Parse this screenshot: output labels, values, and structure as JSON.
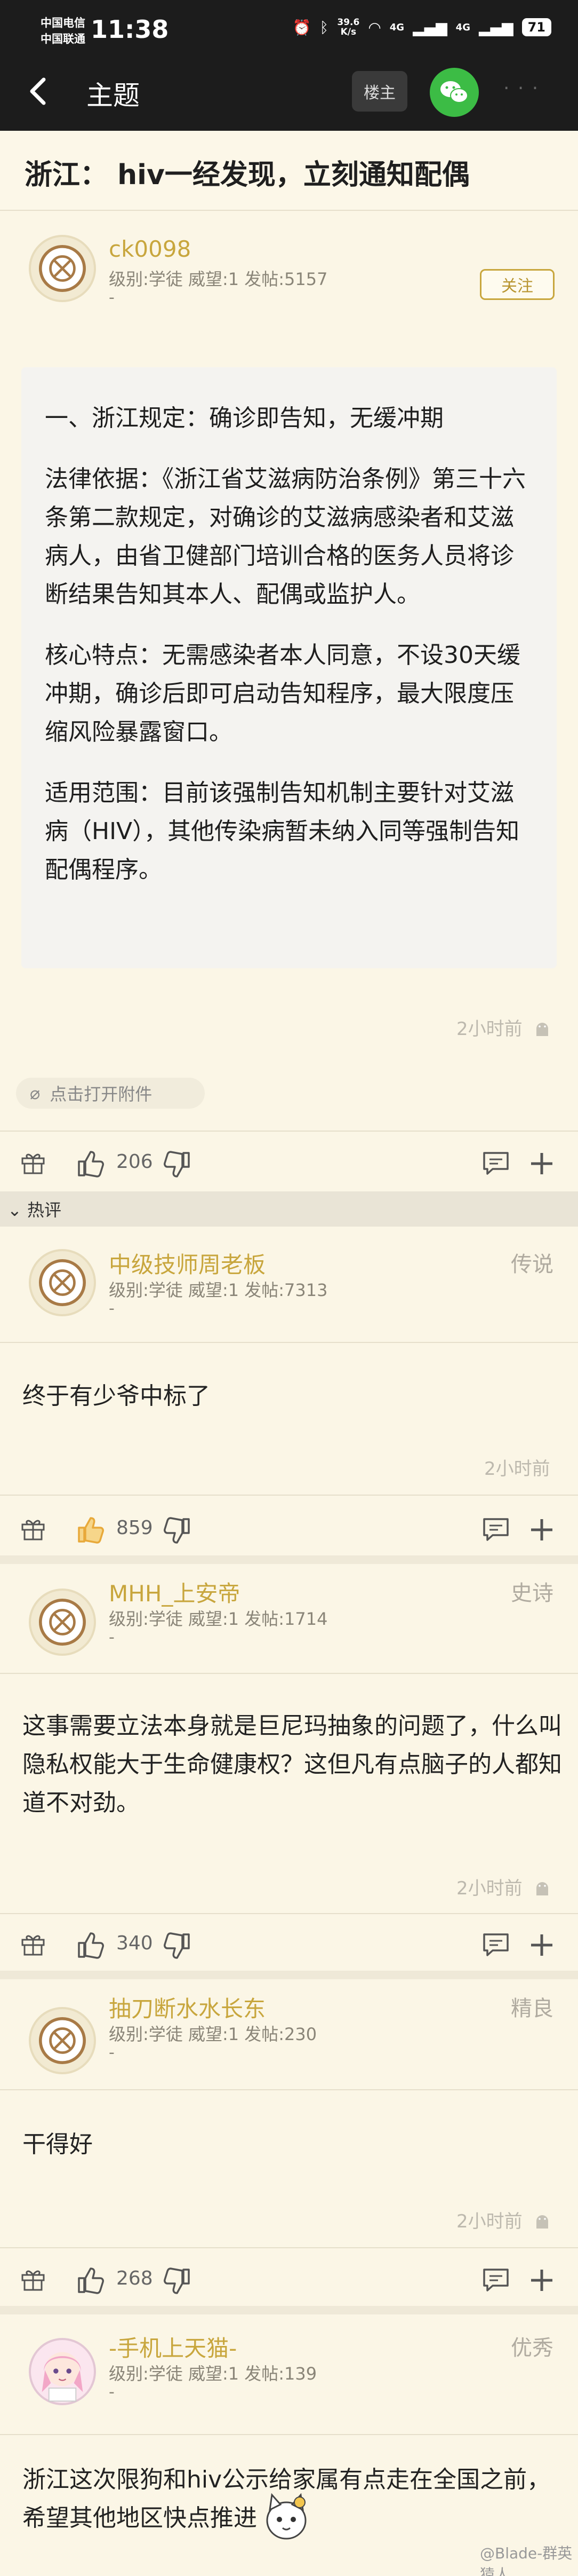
{
  "status_bar": {
    "carrier_1": "中国电信",
    "carrier_2": "中国联通",
    "time": "11:38",
    "net_speed_value": "39.6",
    "net_speed_unit": "K/s",
    "signal_1": "4G",
    "signal_2": "4G",
    "battery": "71"
  },
  "nav": {
    "title": "主题",
    "op_button": "楼主"
  },
  "thread": {
    "title": "浙江： hiv一经发现，立刻通知配偶"
  },
  "main_post": {
    "username": "ck0098",
    "meta": "级别:学徒  威望:1  发帖:5157",
    "dash": "-",
    "follow_label": "关注",
    "paragraphs": [
      "一、浙江规定：确诊即告知，无缓冲期",
      "法律依据：《浙江省艾滋病防治条例》第三十六条第二款规定，对确诊的艾滋病感染者和艾滋病人，由省卫健部门培训合格的医务人员将诊断结果告知其本人、配偶或监护人。",
      "核心特点：无需感染者本人同意，不设30天缓冲期，确诊后即可启动告知程序，最大限度压缩风险暴露窗口。",
      "适用范围：目前该强制告知机制主要针对艾滋病（HIV），其他传染病暂未纳入同等强制告知配偶程序。"
    ],
    "time": "2小时前",
    "attachment_label": "点击打开附件",
    "likes": "206"
  },
  "hot_label": "热评",
  "replies": [
    {
      "username": "中级技师周老板",
      "meta": "级别:学徒  威望:1  发帖:7313",
      "dash": "-",
      "rank": "传说",
      "body": "终于有少爷中标了",
      "time": "2小时前",
      "likes": "859"
    },
    {
      "username": "MHH_上安帝",
      "meta": "级别:学徒  威望:1  发帖:1714",
      "dash": "-",
      "rank": "史诗",
      "body": "这事需要立法本身就是巨尼玛抽象的问题了，什么叫隐私权能大于生命健康权？这但凡有点脑子的人都知道不对劲。",
      "time": "2小时前",
      "likes": "340"
    },
    {
      "username": "抽刀断水水长东",
      "meta": "级别:学徒  威望:1  发帖:230",
      "dash": "-",
      "rank": "精良",
      "body": "干得好",
      "time": "2小时前",
      "likes": "268"
    },
    {
      "username": "-手机上天猫-",
      "meta": "级别:学徒  威望:1  发帖:139",
      "dash": "-",
      "rank": "优秀",
      "body": "浙江这次限狗和hiv公示给家属有点走在全国之前，希望其他地区快点推进"
    }
  ],
  "watermark": "@Blade-群英猿人",
  "colors": {
    "username_gold": "#c8a63d",
    "background": "#fbf6e6",
    "wechat_green": "#3cbc45",
    "liked_orange": "#e8a93a"
  }
}
